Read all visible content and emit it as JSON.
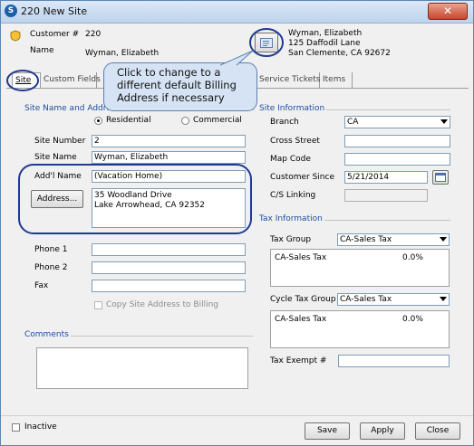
{
  "window": {
    "title": "220 New Site",
    "close_symbol": "✕"
  },
  "header": {
    "customer_label": "Customer #",
    "customer_number": "220",
    "name_label": "Name",
    "name_value": "Wyman, Elizabeth",
    "billing_address_lines": [
      "Wyman, Elizabeth",
      "125 Daffodil Lane",
      "San Clemente, CA  92672"
    ]
  },
  "callout": {
    "text": "Click to change to a different default Billing Address if necessary"
  },
  "tabs": [
    "Site",
    "Custom Fields",
    "Service Tickets",
    "Items"
  ],
  "site_section": {
    "title": "Site Name and Address",
    "residential_label": "Residential",
    "commercial_label": "Commercial",
    "site_number_label": "Site Number",
    "site_number_value": "2",
    "site_name_label": "Site Name",
    "site_name_value": "Wyman, Elizabeth",
    "addl_name_label": "Add'l Name",
    "addl_name_value": "(Vacation Home)",
    "address_button": "Address...",
    "address_lines": [
      "35 Woodland Drive",
      "Lake Arrowhead, CA  92352"
    ],
    "phone1_label": "Phone 1",
    "phone2_label": "Phone 2",
    "fax_label": "Fax",
    "copy_label": "Copy Site Address to Billing"
  },
  "comments": {
    "title": "Comments"
  },
  "site_info": {
    "title": "Site Information",
    "branch_label": "Branch",
    "branch_value": "CA",
    "cross_street_label": "Cross Street",
    "map_code_label": "Map Code",
    "customer_since_label": "Customer Since",
    "customer_since_value": "5/21/2014",
    "cs_linking_label": "C/S Linking"
  },
  "tax_info": {
    "title": "Tax Information",
    "tax_group_label": "Tax Group",
    "tax_group_value": "CA-Sales Tax",
    "tax_group_row": {
      "name": "CA-Sales Tax",
      "rate": "0.0%"
    },
    "cycle_tax_group_label": "Cycle Tax Group",
    "cycle_tax_group_value": "CA-Sales Tax",
    "cycle_tax_row": {
      "name": "CA-Sales Tax",
      "rate": "0.0%"
    },
    "tax_exempt_label": "Tax Exempt #"
  },
  "footer": {
    "inactive_label": "Inactive",
    "save": "Save",
    "apply": "Apply",
    "close": "Close"
  }
}
